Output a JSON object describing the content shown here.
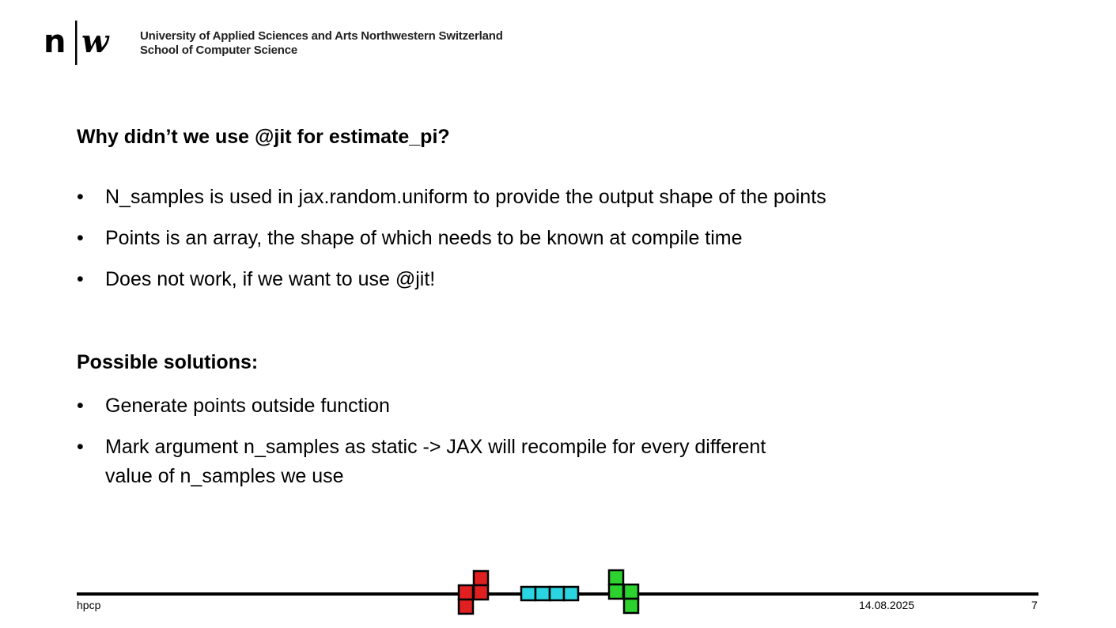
{
  "header": {
    "logo_text": "n|w",
    "institution": "University of Applied Sciences and Arts Northwestern Switzerland",
    "school": "School of Computer Science"
  },
  "slide": {
    "heading1": "Why didn’t we use @jit for estimate_pi?",
    "bullets1": [
      "N_samples is used in jax.random.uniform to provide the output shape of the points",
      "Points is an array, the shape of which needs to be known at compile time",
      "Does not work, if we want to use @jit!"
    ],
    "heading2": "Possible solutions:",
    "bullets2": [
      "Generate points outside function",
      "Mark argument n_samples as static -> JAX will recompile for every different",
      "value of n_samples we use"
    ],
    "bullet_glyph": "•"
  },
  "footer": {
    "left": "hpcp",
    "date": "14.08.2025",
    "page": "7"
  },
  "colors": {
    "tetris_red": "#e02020",
    "tetris_cyan": "#2ad4e0",
    "tetris_green": "#2ed22e"
  }
}
